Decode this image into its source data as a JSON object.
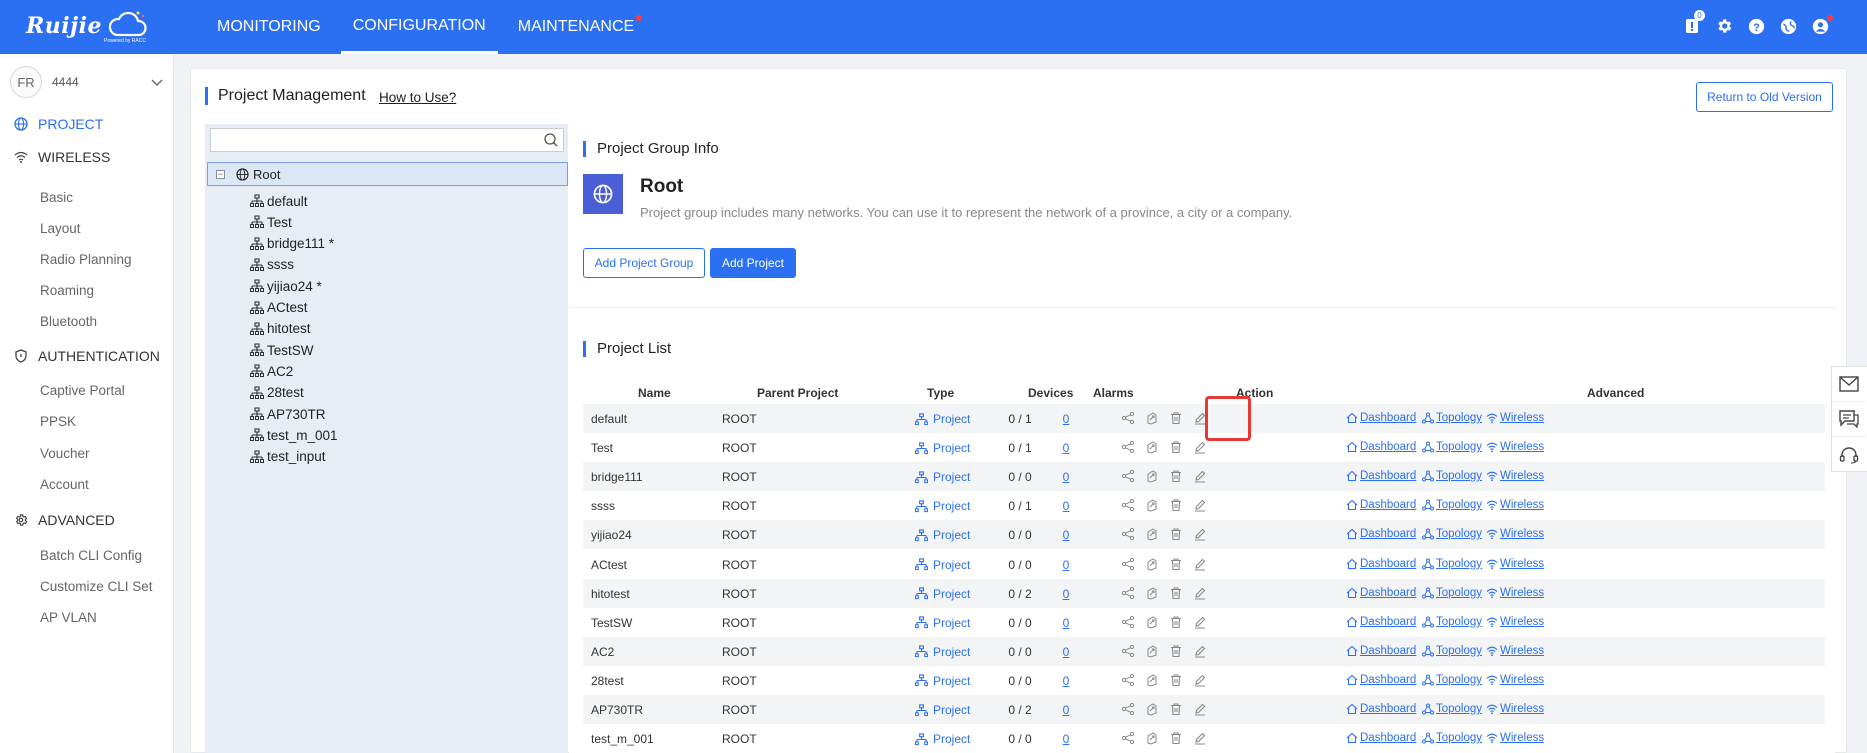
{
  "topbar": {
    "logo": "Ruijie",
    "logo_sub": "Powered by RACC",
    "nav": [
      "MONITORING",
      "CONFIGURATION",
      "MAINTENANCE"
    ],
    "active_nav": "CONFIGURATION",
    "notification_count": "0"
  },
  "sidebar": {
    "avatar_initials": "FR",
    "user": "4444",
    "sections": {
      "project": "PROJECT",
      "wireless": "WIRELESS",
      "authentication": "AUTHENTICATION",
      "advanced": "ADVANCED"
    },
    "wireless_items": [
      "Basic",
      "Layout",
      "Radio Planning",
      "Roaming",
      "Bluetooth"
    ],
    "auth_items": [
      "Captive Portal",
      "PPSK",
      "Voucher",
      "Account"
    ],
    "advanced_items": [
      "Batch CLI Config",
      "Customize CLI Set",
      "AP VLAN"
    ]
  },
  "page": {
    "title": "Project Management",
    "how_to": "How to Use?",
    "return_btn": "Return to Old Version"
  },
  "tree": {
    "search_placeholder": "",
    "root": "Root",
    "items": [
      "default",
      "Test",
      "bridge111 *",
      "ssss",
      "yijiao24 *",
      "ACtest",
      "hitotest",
      "TestSW",
      "AC2",
      "28test",
      "AP730TR",
      "test_m_001",
      "test_input"
    ]
  },
  "group_info": {
    "section_title": "Project Group Info",
    "name": "Root",
    "description": "Project group includes many networks. You can use it to represent the network of a province, a city or a company.",
    "add_group_btn": "Add Project Group",
    "add_project_btn": "Add Project"
  },
  "project_list": {
    "section_title": "Project List",
    "columns": {
      "name": "Name",
      "parent": "Parent Project",
      "type": "Type",
      "devices": "Devices",
      "alarms": "Alarms",
      "action": "Action",
      "advanced": "Advanced"
    },
    "adv_links": {
      "dashboard": "Dashboard",
      "topology": "Topology",
      "wireless": "Wireless"
    },
    "rows": [
      {
        "name": "default",
        "parent": "ROOT",
        "type": "Project",
        "devices": "0 / 1",
        "alarms": "0"
      },
      {
        "name": "Test",
        "parent": "ROOT",
        "type": "Project",
        "devices": "0 / 1",
        "alarms": "0"
      },
      {
        "name": "bridge111",
        "parent": "ROOT",
        "type": "Project",
        "devices": "0 / 0",
        "alarms": "0"
      },
      {
        "name": "ssss",
        "parent": "ROOT",
        "type": "Project",
        "devices": "0 / 1",
        "alarms": "0"
      },
      {
        "name": "yijiao24",
        "parent": "ROOT",
        "type": "Project",
        "devices": "0 / 0",
        "alarms": "0"
      },
      {
        "name": "ACtest",
        "parent": "ROOT",
        "type": "Project",
        "devices": "0 / 0",
        "alarms": "0"
      },
      {
        "name": "hitotest",
        "parent": "ROOT",
        "type": "Project",
        "devices": "0 / 2",
        "alarms": "0"
      },
      {
        "name": "TestSW",
        "parent": "ROOT",
        "type": "Project",
        "devices": "0 / 0",
        "alarms": "0"
      },
      {
        "name": "AC2",
        "parent": "ROOT",
        "type": "Project",
        "devices": "0 / 0",
        "alarms": "0"
      },
      {
        "name": "28test",
        "parent": "ROOT",
        "type": "Project",
        "devices": "0 / 0",
        "alarms": "0"
      },
      {
        "name": "AP730TR",
        "parent": "ROOT",
        "type": "Project",
        "devices": "0 / 2",
        "alarms": "0"
      },
      {
        "name": "test_m_001",
        "parent": "ROOT",
        "type": "Project",
        "devices": "0 / 0",
        "alarms": "0"
      }
    ]
  },
  "colors": {
    "primary": "#2b6ff2",
    "highlight": "#e53935",
    "group_icon_bg": "#4a5fd6",
    "tree_bg": "#e8edf5"
  }
}
